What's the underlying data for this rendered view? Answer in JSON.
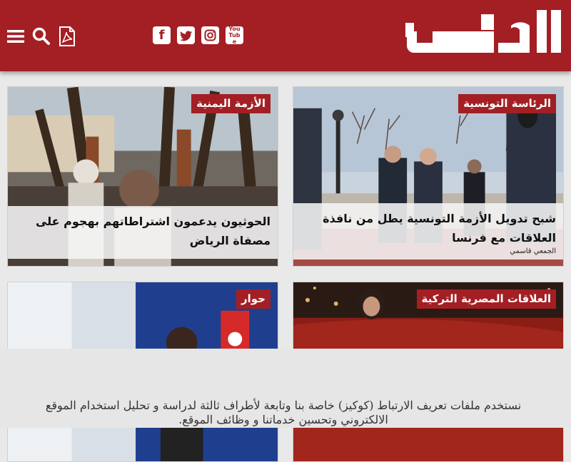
{
  "header": {
    "logo_text": "العرب",
    "icons": [
      "menu-icon",
      "search-icon",
      "pdf-icon"
    ],
    "social": [
      "facebook-icon",
      "twitter-icon",
      "instagram-icon",
      "youtube-icon"
    ],
    "youtube_label": "You Tube"
  },
  "articles": [
    {
      "tag": "الرئاسة التونسية",
      "title": "شبح تدويل الأزمة التونسية يطل من نافذة العلاقات مع فرنسا",
      "author": "الجمعي قاسمي"
    },
    {
      "tag": "الأزمة اليمنية",
      "title": "الحوثيون يدعمون اشتراطاتهم بهجوم على مصفاة الرياض",
      "author": ""
    },
    {
      "tag": "العلاقات المصرية التركية",
      "title": "",
      "author": ""
    },
    {
      "tag": "حوار",
      "title": "",
      "author": ""
    }
  ],
  "cookie_notice": "نستخدم ملفات تعريف الارتباط (كوكيز) خاصة بنا وتابعة لأطراف ثالثة لدراسة و تحليل استخدام الموقع الالكتروني وتحسين خدماتنا و وظائف الموقع.",
  "colors": {
    "brand": "#a31f24",
    "background": "#e9e9e9"
  }
}
